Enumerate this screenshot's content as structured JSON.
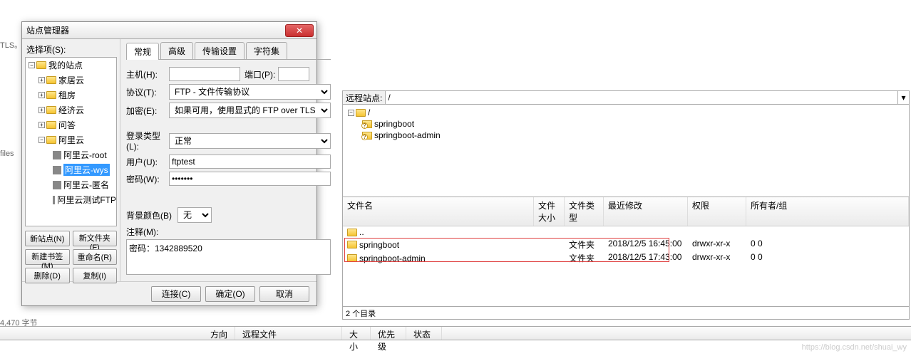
{
  "bg": {
    "tls": "TLS。",
    "files": "files",
    "bytes": "4,470 字节"
  },
  "dialog": {
    "title": "站点管理器",
    "selectLabel": "选择项(S):",
    "tree": {
      "root": "我的站点",
      "items": [
        "家居云",
        "租房",
        "经济云",
        "问答",
        "阿里云"
      ],
      "subitems": [
        "阿里云-root",
        "阿里云-wys",
        "阿里云-匿名",
        "阿里云测试FTP"
      ]
    },
    "buttons": {
      "newSite": "新站点(N)",
      "newFolder": "新文件夹(F)",
      "newBookmark": "新建书签(M)",
      "rename": "重命名(R)",
      "delete": "删除(D)",
      "copy": "复制(I)"
    },
    "tabs": [
      "常规",
      "高级",
      "传输设置",
      "字符集"
    ],
    "form": {
      "hostLabel": "主机(H):",
      "hostValue": "",
      "portLabel": "端口(P):",
      "portValue": "",
      "protocolLabel": "协议(T):",
      "protocolValue": "FTP - 文件传输协议",
      "encryptLabel": "加密(E):",
      "encryptValue": "如果可用，使用显式的 FTP over TLS",
      "loginTypeLabel": "登录类型(L):",
      "loginTypeValue": "正常",
      "userLabel": "用户(U):",
      "userValue": "ftptest",
      "passLabel": "密码(W):",
      "passValue": "•••••••",
      "bgColorLabel": "背景颜色(B)",
      "bgColorValue": "无",
      "commentLabel": "注释(M):",
      "commentValue": "密码：1342889520"
    },
    "footer": {
      "connect": "连接(C)",
      "ok": "确定(O)",
      "cancel": "取消"
    }
  },
  "remote": {
    "label": "远程站点:",
    "path": "/",
    "tree": {
      "root": "/",
      "items": [
        "springboot",
        "springboot-admin"
      ]
    },
    "columns": {
      "name": "文件名",
      "size": "文件大小",
      "type": "文件类型",
      "date": "最近修改",
      "perm": "权限",
      "owner": "所有者/组"
    },
    "rows": [
      {
        "name": "..",
        "type": "",
        "date": "",
        "perm": "",
        "owner": ""
      },
      {
        "name": "springboot",
        "type": "文件夹",
        "date": "2018/12/5 16:45:00",
        "perm": "drwxr-xr-x",
        "owner": "0 0"
      },
      {
        "name": "springboot-admin",
        "type": "文件夹",
        "date": "2018/12/5 17:43:00",
        "perm": "drwxr-xr-x",
        "owner": "0 0"
      }
    ],
    "status": "2 个目录"
  },
  "queue": {
    "direction": "方向",
    "remoteFile": "远程文件",
    "size": "大小",
    "priority": "优先级",
    "status": "状态"
  },
  "watermark": "https://blog.csdn.net/shuai_wy"
}
